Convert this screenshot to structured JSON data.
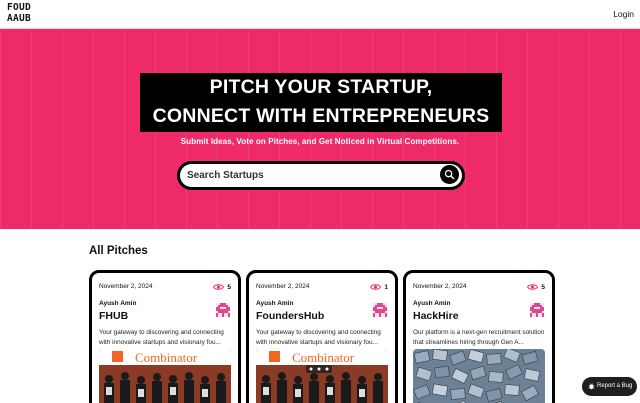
{
  "header": {
    "logo": {
      "line1": "FOUD",
      "line2": "AAUB"
    },
    "login_label": "Login"
  },
  "hero": {
    "title_line1": "PITCH YOUR STARTUP,",
    "title_line2": "CONNECT WITH ENTREPRENEURS",
    "subtitle": "Submit Ideas, Vote on Pitches, and Get Noticed in Virtual Competitions.",
    "search": {
      "placeholder": "Search Startups",
      "value": ""
    }
  },
  "section": {
    "title": "All Pitches"
  },
  "cards": [
    {
      "date": "November 2, 2024",
      "views": "5",
      "author": "Ayush Amin",
      "title": "FHUB",
      "description": "Your gateway to discovering and connecting with innovative startups and visionary fou...",
      "image_banner_text": "Combinator"
    },
    {
      "date": "November 2, 2024",
      "views": "1",
      "author": "Ayush Amin",
      "title": "FoundersHub",
      "description": "Your gateway to discovering and connecting with innovative startups and visionary fou...",
      "image_banner_text": "Combinator"
    },
    {
      "date": "November 2, 2024",
      "views": "5",
      "author": "Ayush Amin",
      "title": "HackHire",
      "description": "Our platform is a next-gen recruitment solution that streamlines hiring through Gen A...",
      "image_banner_text": ""
    }
  ],
  "report_bug_label": "Report a Bug",
  "colors": {
    "accent": "#ee2b68",
    "dark": "#000000"
  },
  "icons": {
    "search": "search-icon",
    "views": "eye-icon",
    "bug": "bug-icon",
    "avatar": "pixel-avatar-icon"
  }
}
